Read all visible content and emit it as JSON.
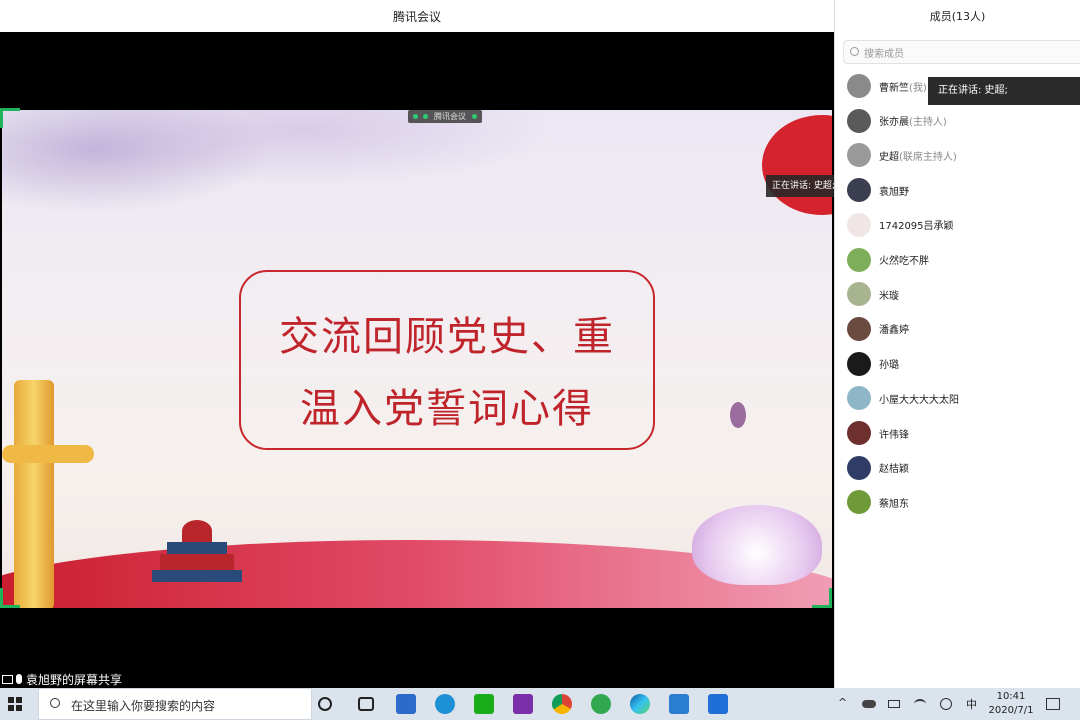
{
  "window": {
    "title": "腾讯会议"
  },
  "share_overlay": {
    "label": "腾讯会议"
  },
  "slide": {
    "line1": "交流回顾党史、重",
    "line2": "温入党誓词心得"
  },
  "speaking_tag": "正在讲话: 史超; 袁",
  "share_label": "袁旭野的屏幕共享",
  "panel": {
    "header": "成员(13人)",
    "search_placeholder": "搜索成员",
    "speaker_popup": "正在讲话: 史超;",
    "members": [
      {
        "name": "曹新竺",
        "role": "(我)",
        "color": "#8a8a8a"
      },
      {
        "name": "张亦晨",
        "role": "(主持人)",
        "color": "#5a5a5a"
      },
      {
        "name": "史超",
        "role": "(联席主持人)",
        "color": "#9a9a9a"
      },
      {
        "name": "袁旭野",
        "role": "",
        "color": "#3c3f52"
      },
      {
        "name": "1742095吕承颖",
        "role": "",
        "color": "#f1e6e6"
      },
      {
        "name": "火然吃不胖",
        "role": "",
        "color": "#7fae5a"
      },
      {
        "name": "米璇",
        "role": "",
        "color": "#a7b48f"
      },
      {
        "name": "潘鑫婷",
        "role": "",
        "color": "#6b4a3f"
      },
      {
        "name": "孙璐",
        "role": "",
        "color": "#1a1a1a"
      },
      {
        "name": "小屋大大大大太阳",
        "role": "",
        "color": "#8fb6c6"
      },
      {
        "name": "许伟锋",
        "role": "",
        "color": "#6e2f2f"
      },
      {
        "name": "赵桔颖",
        "role": "",
        "color": "#2f3d66"
      },
      {
        "name": "蔡旭东",
        "role": "",
        "color": "#6f9a3a"
      }
    ]
  },
  "taskbar": {
    "search_placeholder": "在这里输入你要搜索的内容",
    "ime": "中",
    "time": "10:41",
    "date": "2020/7/1"
  }
}
